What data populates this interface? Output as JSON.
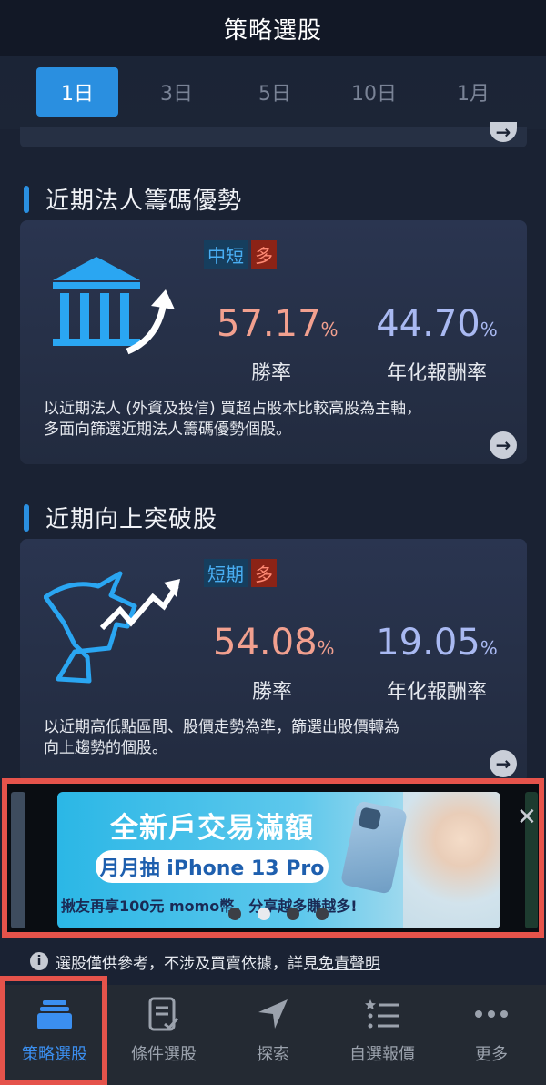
{
  "header": {
    "title": "策略選股"
  },
  "tabs": [
    {
      "label": "1日",
      "active": true
    },
    {
      "label": "3日",
      "active": false
    },
    {
      "label": "5日",
      "active": false
    },
    {
      "label": "10日",
      "active": false
    },
    {
      "label": "1月",
      "active": false
    }
  ],
  "sections": [
    {
      "title": "近期法人籌碼優勢",
      "term_tag": "中短",
      "direction_tag": "多",
      "win_rate_value": "57.17",
      "win_rate_unit": "%",
      "win_rate_label": "勝率",
      "annual_value": "44.70",
      "annual_unit": "%",
      "annual_label": "年化報酬率",
      "desc_line1": "以近期法人 (外資及投信) 買超占股本比較高股為主軸，",
      "desc_line2": "多面向篩選近期法人籌碼優勢個股。",
      "icon": "bank-building-icon"
    },
    {
      "title": "近期向上突破股",
      "term_tag": "短期",
      "direction_tag": "多",
      "win_rate_value": "54.08",
      "win_rate_unit": "%",
      "win_rate_label": "勝率",
      "annual_value": "19.05",
      "annual_unit": "%",
      "annual_label": "年化報酬率",
      "desc_line1": "以近期高低點區間、股價走勢為準，篩選出股價轉為",
      "desc_line2": "向上趨勢的個股。",
      "icon": "bull-uptrend-icon"
    }
  ],
  "ad": {
    "headline": "全新戶交易滿額",
    "pill": "月月抽 iPhone 13 Pro",
    "sub": "揪友再享100元 momo幣，分享越多賺越多!",
    "close": "✕",
    "active_slide_index": 1,
    "slide_count": 4
  },
  "disclaimer": {
    "text": "選股僅供參考，不涉及買賣依據，詳見",
    "link": "免責聲明"
  },
  "bottom_nav": [
    {
      "label": "策略選股",
      "icon": "strategy-stack-icon",
      "active": true
    },
    {
      "label": "條件選股",
      "icon": "checklist-doc-icon",
      "active": false
    },
    {
      "label": "探索",
      "icon": "navigation-arrow-icon",
      "active": false
    },
    {
      "label": "自選報價",
      "icon": "star-list-icon",
      "active": false
    },
    {
      "label": "更多",
      "icon": "more-dots-icon",
      "active": false
    }
  ],
  "colors": {
    "accent": "#2a8fe0",
    "win_rate": "#f2a08f",
    "annual": "#a9b9f2",
    "highlight_border": "#e5534b"
  }
}
